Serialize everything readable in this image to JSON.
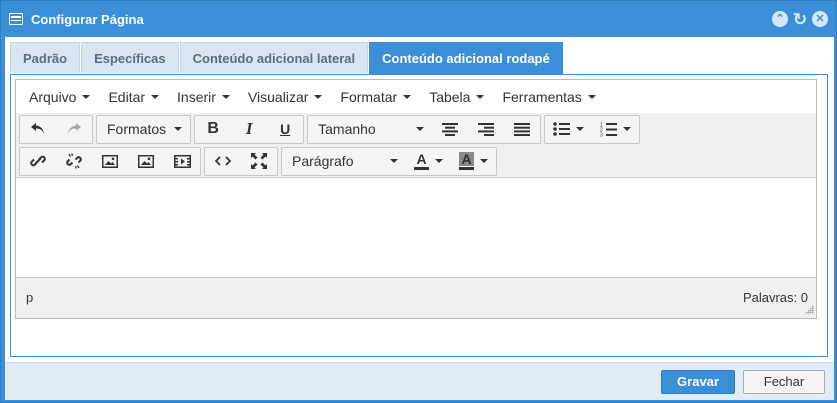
{
  "window": {
    "title": "Configurar Página"
  },
  "tabs": [
    {
      "label": "Padrão",
      "active": false
    },
    {
      "label": "Específicas",
      "active": false
    },
    {
      "label": "Conteúdo adicional lateral",
      "active": false
    },
    {
      "label": "Conteúdo adicional rodapé",
      "active": true
    }
  ],
  "menubar": [
    "Arquivo",
    "Editar",
    "Inserir",
    "Visualizar",
    "Formatar",
    "Tabela",
    "Ferramentas"
  ],
  "toolbar": {
    "formats_label": "Formatos",
    "size_label": "Tamanho",
    "paragraph_label": "Parágrafo",
    "bold": "B",
    "italic": "I",
    "underline": "U",
    "text_color_glyph": "A",
    "bg_color_glyph": "A",
    "text_color": "#333333",
    "bg_color": "#8a8a8a"
  },
  "editor": {
    "content": ""
  },
  "statusbar": {
    "path": "p",
    "word_count": "Palavras: 0"
  },
  "footer": {
    "save_label": "Gravar",
    "close_label": "Fechar"
  },
  "colors": {
    "accent": "#3a8fd8"
  }
}
